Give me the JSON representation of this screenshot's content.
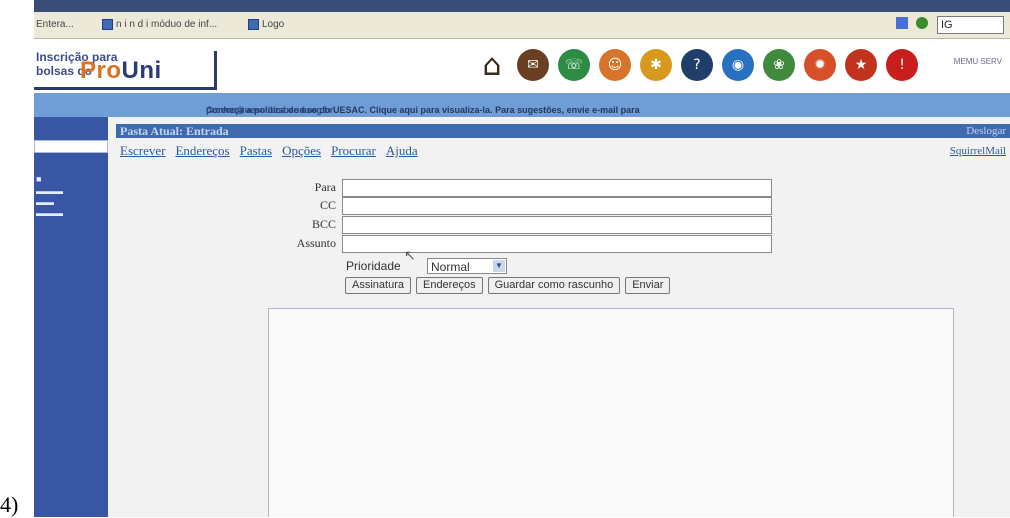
{
  "caption": "4)",
  "browser": {
    "bookmarks": [
      {
        "label": "Entera..."
      },
      {
        "label": "n i n d i móduo de inf..."
      },
      {
        "label": "Logo"
      }
    ],
    "search_text": "IG"
  },
  "banner": {
    "logo_line1": "Inscrição para",
    "logo_line2": "bolsas do",
    "logo_brand_a": "Pro",
    "logo_brand_b": "Uni",
    "user_label": "MEMU SERV"
  },
  "policy_bar": {
    "text": "Conheça a política de uso do UESAC. Clique aqui para visualiza-la. Para sugestões, envie e-mail para ",
    "email": "prosoc@uesc.uesbeud.org.br"
  },
  "folder": {
    "title": "Pasta Atual: Entrada",
    "right_label": "Deslogar"
  },
  "menu": {
    "items": [
      "Escrever",
      "Endereços",
      "Pastas",
      "Opções",
      "Procurar",
      "Ajuda"
    ],
    "right": "SquirrelMail"
  },
  "form": {
    "to_label": "Para",
    "cc_label": "CC",
    "bcc_label": "BCC",
    "subject_label": "Assunto",
    "to_value": "",
    "cc_value": "",
    "bcc_value": "",
    "subject_value": "",
    "priority_label": "Prioridade",
    "priority_value": "Normal"
  },
  "buttons": {
    "signature": "Assinatura",
    "addresses": "Endereços",
    "save_draft": "Guardar como rascunho",
    "send": "Enviar"
  },
  "body": {
    "value": ""
  },
  "nav_icons": [
    {
      "name": "home-icon",
      "color": "#3a2a18"
    },
    {
      "name": "chat-icon",
      "color": "#6a3e22"
    },
    {
      "name": "globe-icon",
      "color": "#2e8b44"
    },
    {
      "name": "smile-icon",
      "color": "#d8742a"
    },
    {
      "name": "people-icon",
      "color": "#d89a1e"
    },
    {
      "name": "help-icon",
      "color": "#1f3f6a"
    },
    {
      "name": "world-icon",
      "color": "#2870c0"
    },
    {
      "name": "leaf-icon",
      "color": "#3f8a3c"
    },
    {
      "name": "fire-icon",
      "color": "#d8502a"
    },
    {
      "name": "star-icon",
      "color": "#c2331e"
    },
    {
      "name": "alert-icon",
      "color": "#c81e1e"
    }
  ],
  "colors": {
    "policy_bar": "#6f9ed6",
    "sidebar": "#3856a3",
    "folder_bar": "#3f6aae",
    "link": "#2c5aa0"
  }
}
